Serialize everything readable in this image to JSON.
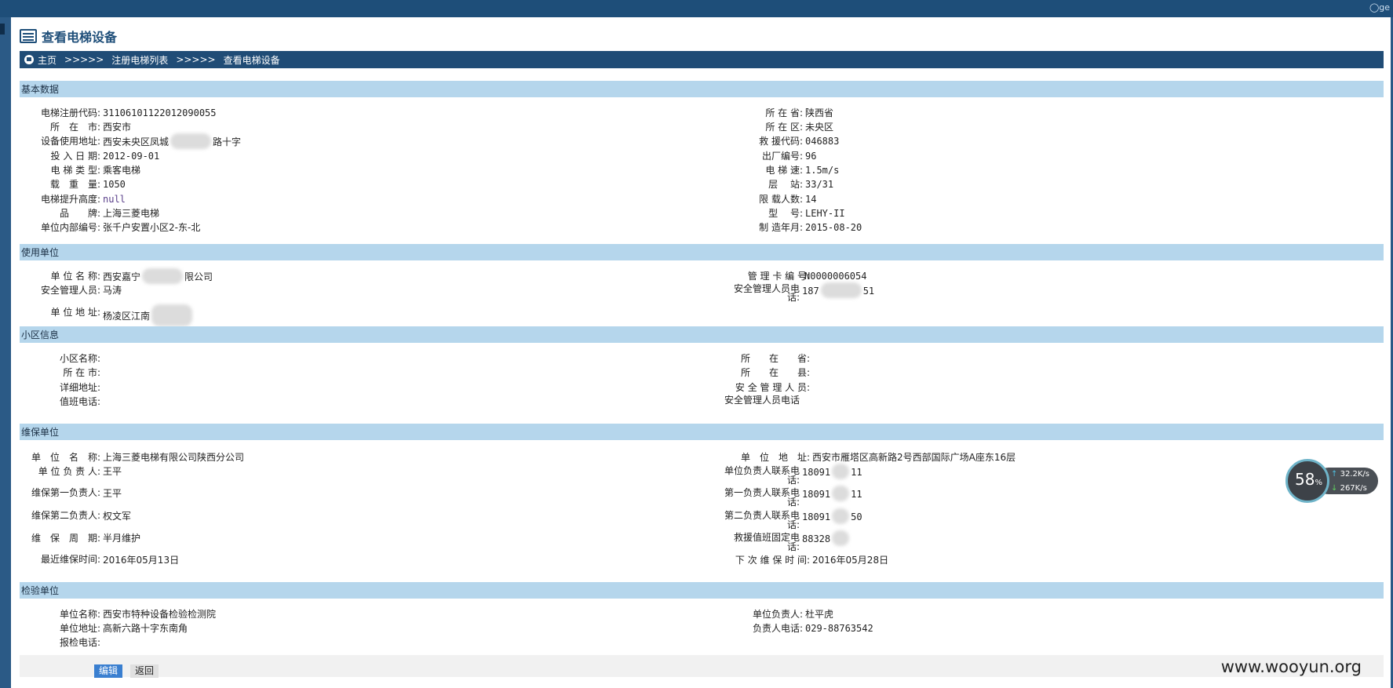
{
  "top_user": "ge",
  "page_title": "查看电梯设备",
  "breadcrumb": [
    "主页",
    ">>>>>",
    "注册电梯列表",
    ">>>>>",
    "查看电梯设备"
  ],
  "sections": {
    "basic": "基本数据",
    "user_unit": "使用单位",
    "community": "小区信息",
    "maintenance": "维保单位",
    "inspection": "检验单位"
  },
  "basic": {
    "left": [
      {
        "label": "电梯注册代码:",
        "value": "31106101122012090055"
      },
      {
        "label": "所　在　市:",
        "value": "西安市"
      },
      {
        "label": "设备使用地址:",
        "value": "西安未央区凤城",
        "value2": "路十字"
      },
      {
        "label": "投 入 日 期:",
        "value": "2012-09-01"
      },
      {
        "label": "电 梯 类 型:",
        "value": "乘客电梯"
      },
      {
        "label": "载　重　量:",
        "value": "1050"
      },
      {
        "label": "电梯提升高度:",
        "value": "null"
      },
      {
        "label": "品　　牌:",
        "value": "上海三菱电梯"
      },
      {
        "label": "单位内部编号:",
        "value": "张千户安置小区2-东-北"
      }
    ],
    "right": [
      {
        "label": "所 在 省:",
        "value": "陕西省"
      },
      {
        "label": "所 在 区:",
        "value": "未央区"
      },
      {
        "label": "救 援代码:",
        "value": "046883"
      },
      {
        "label": "出厂编号:",
        "value": "96"
      },
      {
        "label": "电 梯 速:",
        "value": "1.5m/s"
      },
      {
        "label": "层　 站:",
        "value": "33/31"
      },
      {
        "label": "限 载人数:",
        "value": "14"
      },
      {
        "label": "型　 号:",
        "value": "LEHY-II"
      },
      {
        "label": "制 造年月:",
        "value": "2015-08-20"
      }
    ]
  },
  "user_unit": {
    "name_label": "单 位 名 称:",
    "name_value": "西安嘉宁",
    "name_value2": "限公司",
    "manager_label": "安全管理人员:",
    "manager_value": "马涛",
    "address_label": "单 位 地 址:",
    "address_value": "杨凌区江南",
    "card_label": "管 理 卡 编 号:",
    "card_value": "N0000006054",
    "phone_label": "安全管理人员电话:",
    "phone_value": "187",
    "phone_value2": "51"
  },
  "community": {
    "left": [
      {
        "label": "小区名称:",
        "value": ""
      },
      {
        "label": "所 在 市:",
        "value": ""
      },
      {
        "label": "详细地址:",
        "value": ""
      },
      {
        "label": "值班电话:",
        "value": ""
      }
    ],
    "right": [
      {
        "label": "所　　在　　省:",
        "value": ""
      },
      {
        "label": "所　　在　　县:",
        "value": ""
      },
      {
        "label": "安 全 管 理 人 员:",
        "value": ""
      },
      {
        "label": "安全管理人员电话",
        "value": ""
      }
    ]
  },
  "maintenance": {
    "left": [
      {
        "label": "单　位　名　称:",
        "value": "上海三菱电梯有限公司陕西分公司"
      },
      {
        "label": "单 位 负 责 人:",
        "value": "王平"
      },
      {
        "label": "维保第一负责人:",
        "value": "王平"
      },
      {
        "label": "维保第二负责人:",
        "value": "权文军"
      },
      {
        "label": "维　保　周　期:",
        "value": "半月维护"
      },
      {
        "label": "最近维保时间:",
        "value": "2016年05月13日"
      }
    ],
    "right": [
      {
        "label": "单　位　地　址:",
        "value": "西安市雁塔区高新路2号西部国际广场A座东16层"
      },
      {
        "label": "单位负责人联系电话:",
        "value": "18091",
        "value2": "11"
      },
      {
        "label": "第一负责人联系电话:",
        "value": "18091",
        "value2": "11"
      },
      {
        "label": "第二负责人联系电话:",
        "value": "18091",
        "value2": "50"
      },
      {
        "label": "救援值班固定电话:",
        "value": "88328"
      },
      {
        "label": "下 次 维 保 时 间:",
        "value": "2016年05月28日"
      }
    ]
  },
  "inspection": {
    "left": [
      {
        "label": "单位名称:",
        "value": "西安市特种设备检验检测院"
      },
      {
        "label": "单位地址:",
        "value": "高新六路十字东南角"
      },
      {
        "label": "报检电话:",
        "value": ""
      }
    ],
    "right": [
      {
        "label": "单位负责人:",
        "value": "杜平虎"
      },
      {
        "label": "负责人电话:",
        "value": "029-88763542"
      }
    ]
  },
  "buttons": {
    "edit": "编辑",
    "back": "返回"
  },
  "watermark": "www.wooyun.org",
  "speed_widget": {
    "percent": "58",
    "unit": "%",
    "up": "32.2K/s",
    "down": "267K/s"
  }
}
